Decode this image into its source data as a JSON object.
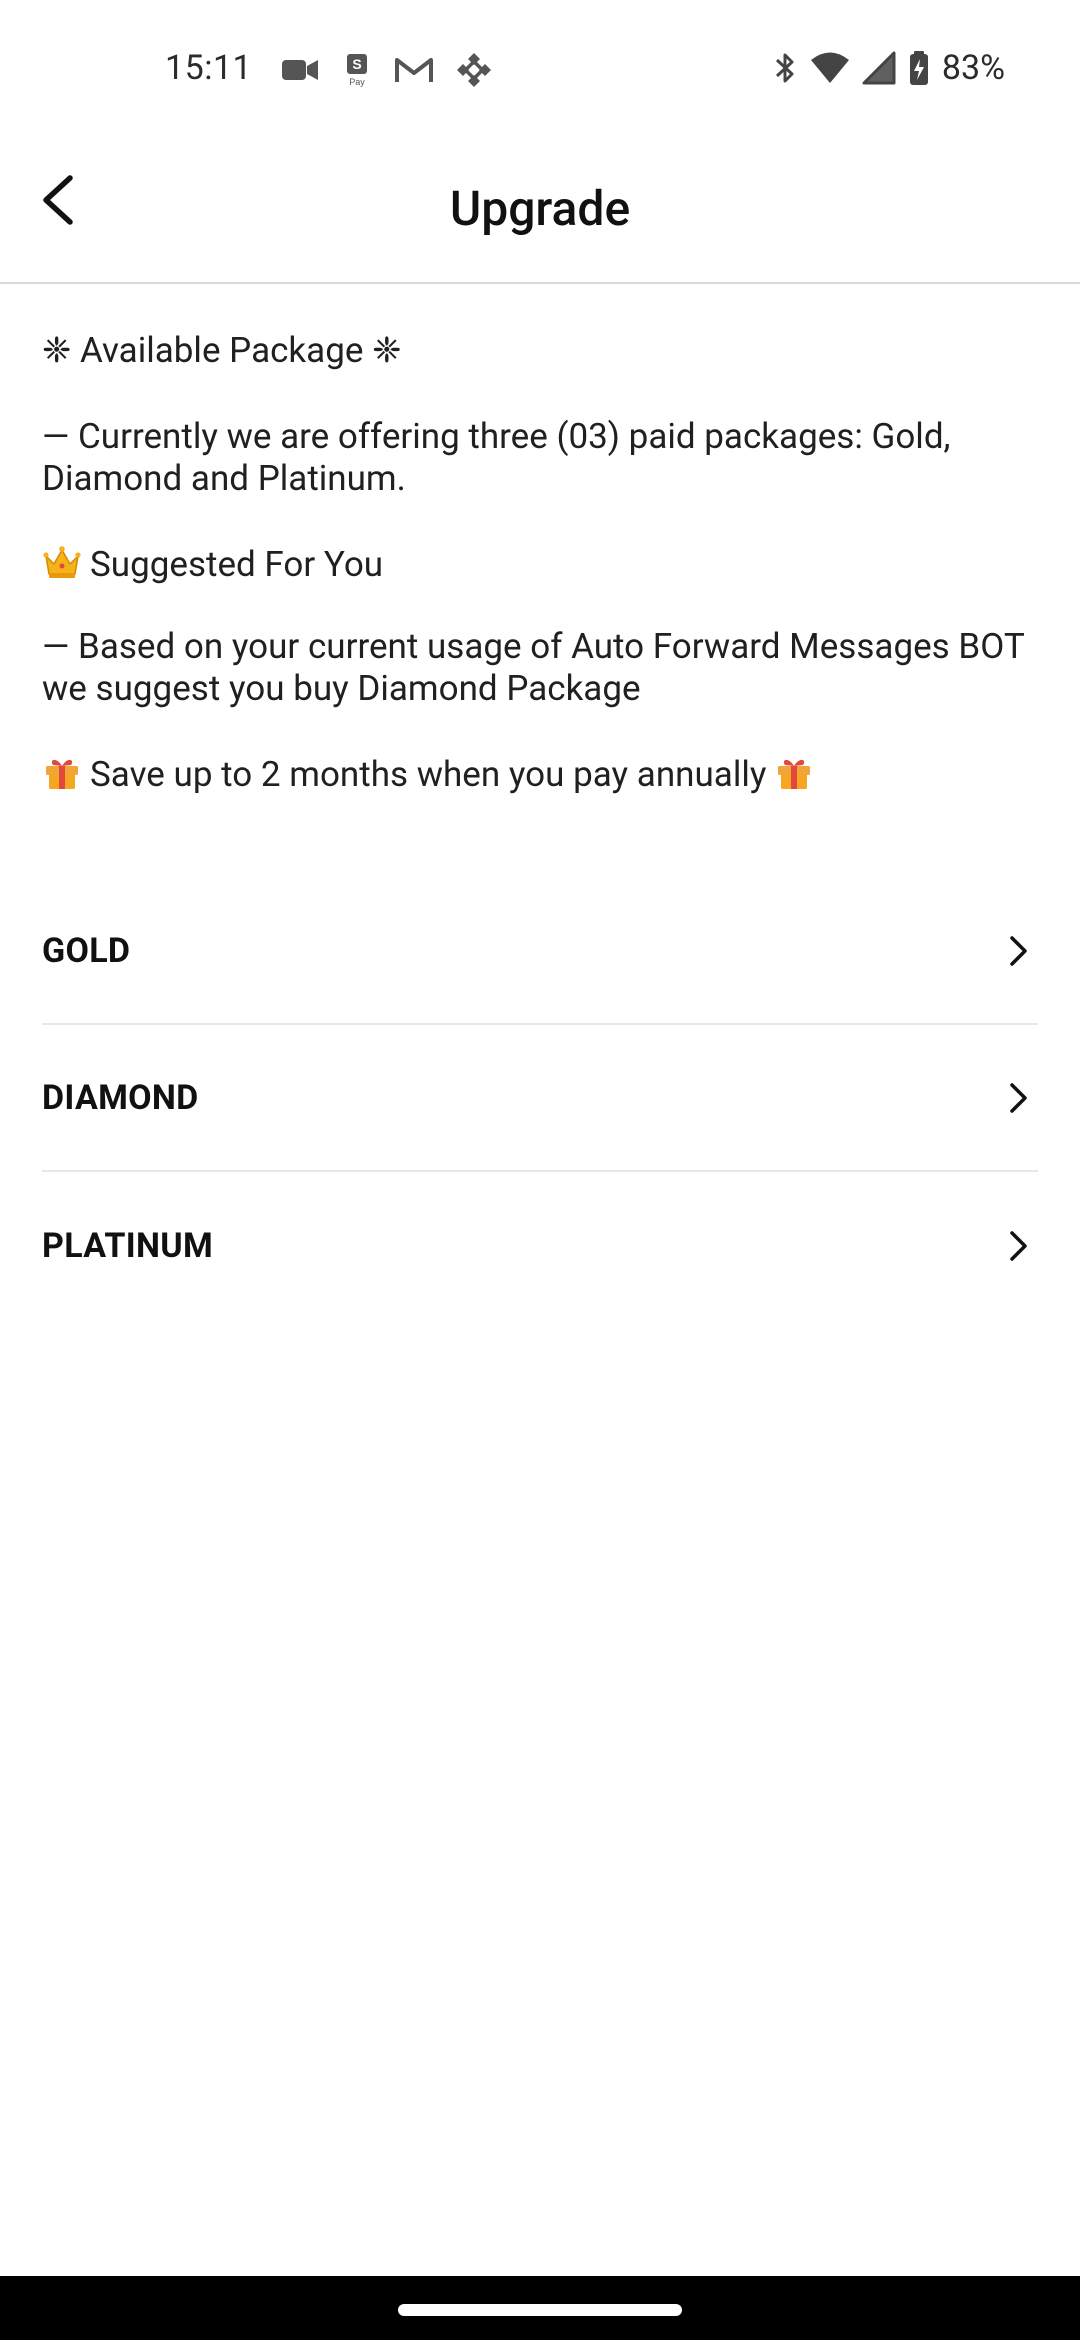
{
  "status_bar": {
    "time": "15:11",
    "battery_percent": "83%",
    "left_icons": [
      "video-camera-icon",
      "s-pay-icon",
      "gmail-icon",
      "binance-icon"
    ],
    "right_icons": [
      "bluetooth-icon",
      "wifi-icon",
      "cell-signal-icon",
      "battery-charging-icon"
    ]
  },
  "app_bar": {
    "title": "Upgrade",
    "back_icon": "back-arrow-icon"
  },
  "content": {
    "available_heading": "❈ Available Package ❈",
    "offering_text": "— Currently we are offering three (03) paid packages: Gold, Diamond and Platinum.",
    "suggested_heading": "Suggested For You",
    "suggestion_text": "— Based on your current usage of Auto Forward Messages BOT we suggest you buy Diamond Package",
    "save_text": "Save up to 2 months when you pay annually"
  },
  "packages": [
    {
      "label": "GOLD"
    },
    {
      "label": "DIAMOND"
    },
    {
      "label": "PLATINUM"
    }
  ],
  "colors": {
    "background": "#ffffff",
    "text": "#202020",
    "divider": "#e6e6e6",
    "nav_bar": "#000000"
  }
}
